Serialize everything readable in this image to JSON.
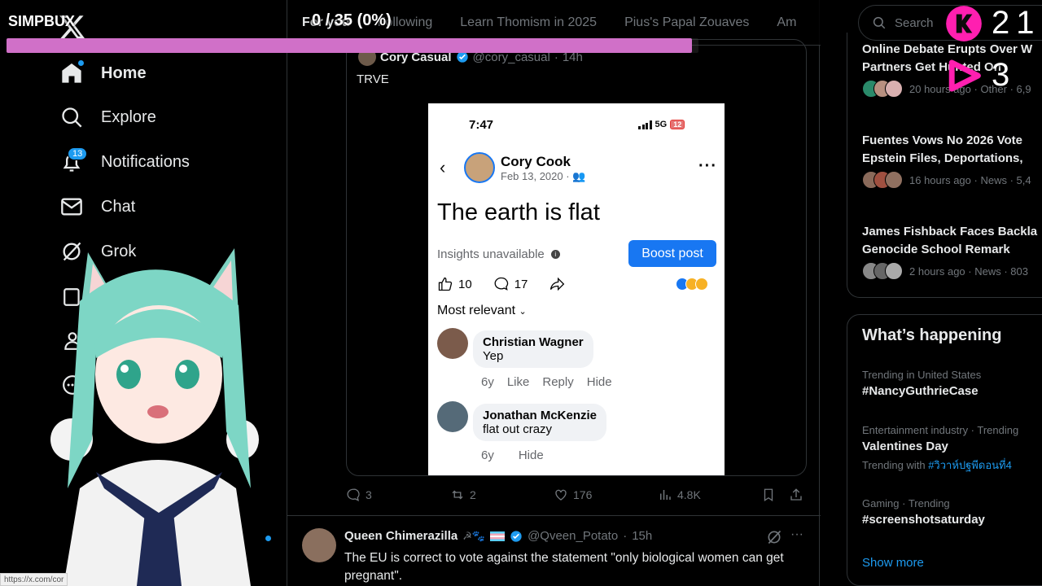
{
  "overlay": {
    "brand": "SIMPBUX",
    "progress_text": "0 / 35 (0%)",
    "progress_fraction": 0.99,
    "kick_count": "21",
    "play_count": "3",
    "status_url": "https://x.com/cor"
  },
  "nav": {
    "items": [
      {
        "label": "Home",
        "icon": "home-icon"
      },
      {
        "label": "Explore",
        "icon": "search-icon"
      },
      {
        "label": "Notifications",
        "icon": "bell-icon",
        "badge": "13"
      },
      {
        "label": "Chat",
        "icon": "mail-icon"
      },
      {
        "label": "Grok",
        "icon": "grok-icon"
      }
    ]
  },
  "tabs": [
    "For you",
    "Following",
    "Learn Thomism in 2025",
    "Pius's Papal Zouaves",
    "Am"
  ],
  "quoted": {
    "name": "Cory Casual",
    "handle": "@cory_casual",
    "time": "14h",
    "text": "TRVE"
  },
  "fb": {
    "time": "7:47",
    "network": "5G",
    "battery": "12",
    "name": "Cory Cook",
    "date": "Feb 13, 2020 ·",
    "post": "The earth is flat",
    "insights": "Insights unavailable",
    "boost": "Boost post",
    "likes": "10",
    "comments": "17",
    "sort": "Most relevant",
    "comment1": {
      "name": "Christian Wagner",
      "text": "Yep",
      "age": "6y",
      "like": "Like",
      "reply": "Reply",
      "hide": "Hide"
    },
    "comment2": {
      "name": "Jonathan McKenzie",
      "text": "flat out crazy",
      "age": "6y",
      "hide": "Hide"
    }
  },
  "post_actions": {
    "replies": "3",
    "reposts": "2",
    "likes": "176",
    "views": "4.8K"
  },
  "post2": {
    "name": "Queen Chimerazilla",
    "handle": "@Qveen_Potato",
    "time": "15h",
    "text": "The EU is correct to vote against the statement \"only biological women can get pregnant\"."
  },
  "search": {
    "placeholder": "Search"
  },
  "news": [
    {
      "title": "Online Debate Erupts Over W",
      "title2": "Partners Get Hunted On",
      "meta": "20 hours ago · Other · 6,9"
    },
    {
      "title": "Fuentes Vows No 2026 Vote",
      "title2": "Epstein Files, Deportations,",
      "meta": "16 hours ago · News · 5,4"
    },
    {
      "title": "James Fishback Faces Backla",
      "title2": "Genocide School Remark",
      "meta": "2 hours ago · News · 803"
    }
  ],
  "happening": {
    "title": "What’s happening",
    "trends": [
      {
        "context": "Trending in United States",
        "name": "#NancyGuthrieCase"
      },
      {
        "context": "Entertainment industry · Trending",
        "name": "Valentines Day",
        "with_label": "Trending with",
        "with_tag": "#วิวาห์ปฐพีดอนที่4"
      },
      {
        "context": "Gaming · Trending",
        "name": "#screenshotsaturday"
      }
    ],
    "show_more": "Show more"
  },
  "colors": {
    "accent": "#1d9bf0",
    "progress": "#d070c8",
    "kick": "#ff1fb0",
    "fb_blue": "#1877f2"
  }
}
